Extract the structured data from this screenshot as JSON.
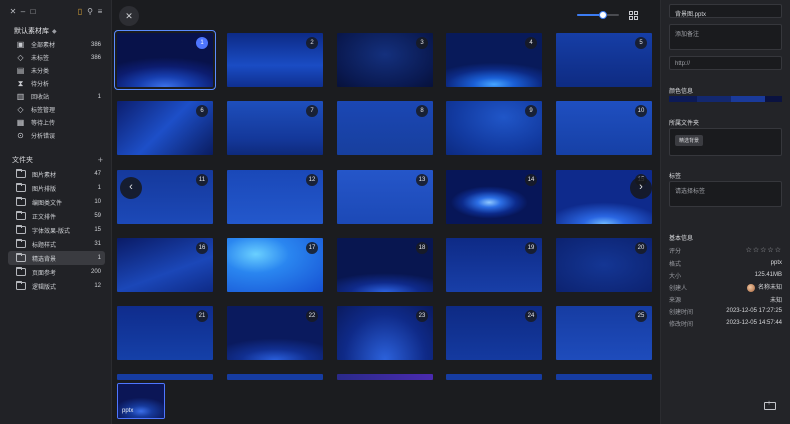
{
  "titlebar": {
    "left_icons": [
      "close-icon",
      "minimize-icon",
      "maximize-icon"
    ],
    "right_icons": [
      "bookmark-icon",
      "pin-icon",
      "menu-icon"
    ],
    "left_glyphs": [
      "✕",
      "–",
      "□"
    ],
    "right_glyphs": [
      "▯",
      "⚲",
      "≡"
    ]
  },
  "sidebar": {
    "library_title": "默认素材库",
    "library_caret": "◆",
    "nav": [
      {
        "label": "全部素材",
        "count": "386",
        "icon": "▣"
      },
      {
        "label": "未标签",
        "count": "386",
        "icon": "◇"
      },
      {
        "label": "未分类",
        "count": "",
        "icon": "▤"
      },
      {
        "label": "待分析",
        "count": "",
        "icon": "⧗"
      },
      {
        "label": "回收站",
        "count": "1",
        "icon": "▥"
      },
      {
        "label": "标签管理",
        "count": "",
        "icon": "◇"
      },
      {
        "label": "等待上传",
        "count": "",
        "icon": "▦"
      },
      {
        "label": "分析错误",
        "count": "",
        "icon": "⊙"
      }
    ],
    "folders_title": "文件夹",
    "folders_add": "+",
    "folders": [
      {
        "label": "图片素材",
        "count": "47"
      },
      {
        "label": "图片排版",
        "count": "1"
      },
      {
        "label": "编图类文件",
        "count": "10"
      },
      {
        "label": "正文排件",
        "count": "59"
      },
      {
        "label": "字体效果-版式",
        "count": "15"
      },
      {
        "label": "标题样式",
        "count": "31"
      },
      {
        "label": "精选背景",
        "count": "1"
      },
      {
        "label": "页面参考",
        "count": "200"
      },
      {
        "label": "逻辑版式",
        "count": "12"
      }
    ],
    "active_folder": 6
  },
  "toolbar": {
    "close_glyph": "✕",
    "zoom_level": 0.62
  },
  "grid": {
    "numbers": [
      "1",
      "2",
      "3",
      "4",
      "5",
      "6",
      "7",
      "8",
      "9",
      "10",
      "11",
      "12",
      "13",
      "14",
      "15",
      "16",
      "17",
      "18",
      "19",
      "20",
      "21",
      "22",
      "23",
      "24",
      "25"
    ],
    "selected": 0,
    "prev_glyph": "‹",
    "next_glyph": "›"
  },
  "tray": {
    "tag": "pptx"
  },
  "panel": {
    "file_name": "背景图.pptx",
    "note_placeholder": "添加备注",
    "url_placeholder": "http://",
    "color_title": "颜色信息",
    "palette": [
      "#0c1a56",
      "#13286f",
      "#1a3a9a",
      "#0a1240"
    ],
    "palette_weights": [
      0.25,
      0.3,
      0.3,
      0.15
    ],
    "folder_title": "所属文件夹",
    "folder_chip": "精选背景",
    "tag_title": "标签",
    "tag_placeholder": "请选择标签",
    "basic_title": "基本信息",
    "rating_label": "评分",
    "rating_stars": "☆☆☆☆☆",
    "format_label": "格式",
    "format_value": "pptx",
    "size_label": "大小",
    "size_value": "125.41MB",
    "creator_label": "创建人",
    "creator_value": "名称未知",
    "source_label": "来源",
    "source_value": "未知",
    "created_label": "创建时间",
    "created_value": "2023-12-05 17:27:25",
    "modified_label": "修改时间",
    "modified_value": "2023-12-05 14:57:44"
  }
}
